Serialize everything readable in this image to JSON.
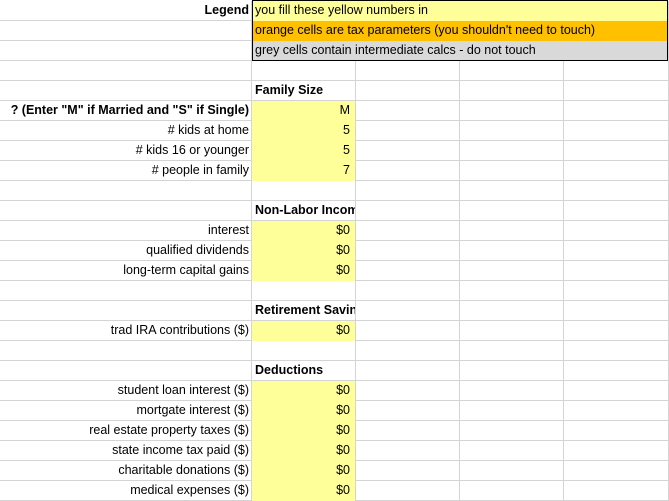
{
  "legend": {
    "label": "Legend",
    "yellow_text": "you fill these yellow numbers in",
    "orange_text": "orange cells are tax parameters (you shouldn't need to touch)",
    "grey_text": "grey cells contain intermediate calcs - do not touch"
  },
  "family": {
    "heading": "Family Size",
    "rows": [
      {
        "label": "? (Enter \"M\" if Married and \"S\" if Single)",
        "value": "M"
      },
      {
        "label": "# kids at home",
        "value": "5"
      },
      {
        "label": "# kids 16 or younger",
        "value": "5"
      },
      {
        "label": "# people in family",
        "value": "7"
      }
    ]
  },
  "nonlabor": {
    "heading": "Non-Labor Income",
    "rows": [
      {
        "label": "interest",
        "value": "$0"
      },
      {
        "label": "qualified dividends",
        "value": "$0"
      },
      {
        "label": "long-term capital gains",
        "value": "$0"
      }
    ]
  },
  "retirement": {
    "heading": "Retirement Savings",
    "rows": [
      {
        "label": "trad IRA contributions ($)",
        "value": "$0"
      }
    ]
  },
  "deductions": {
    "heading": "Deductions",
    "rows": [
      {
        "label": "student loan interest ($)",
        "value": "$0"
      },
      {
        "label": "mortgate interest ($)",
        "value": "$0"
      },
      {
        "label": "real estate property taxes ($)",
        "value": "$0"
      },
      {
        "label": "state income tax paid ($)",
        "value": "$0"
      },
      {
        "label": "charitable donations ($)",
        "value": "$0"
      },
      {
        "label": "medical expenses ($)",
        "value": "$0"
      }
    ]
  },
  "colors": {
    "input_yellow": "#ffff99",
    "param_orange": "#ffc000",
    "calc_grey": "#d9d9d9",
    "gridline": "#d4d4d4"
  }
}
